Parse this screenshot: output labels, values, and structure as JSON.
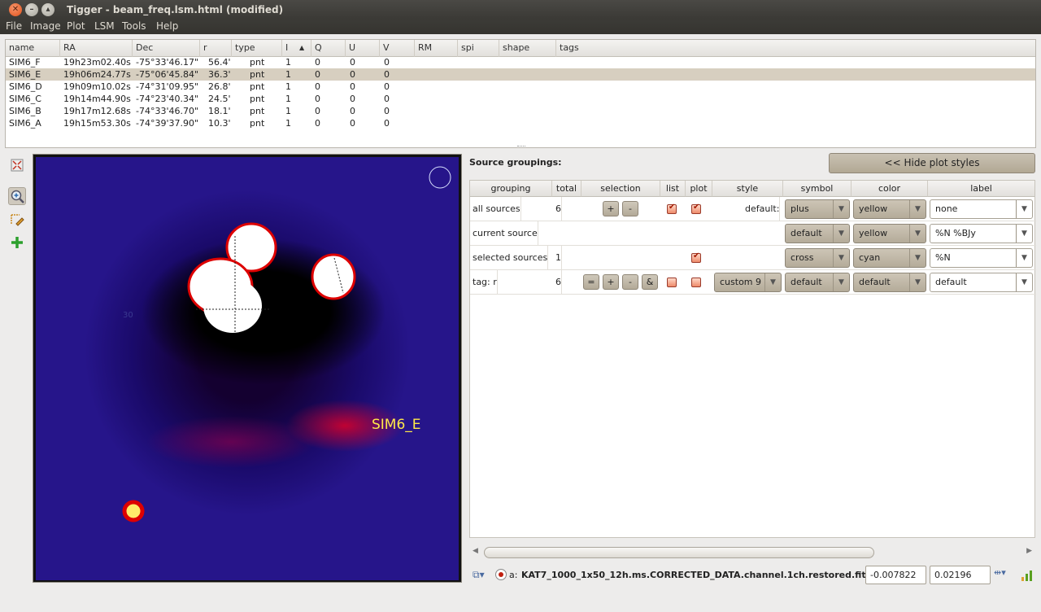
{
  "window": {
    "title": "Tigger - beam_freq.lsm.html (modified)"
  },
  "menu": [
    "File",
    "Image",
    "Plot",
    "LSM",
    "Tools",
    "Help"
  ],
  "source_table": {
    "columns": [
      "name",
      "RA",
      "Dec",
      "r",
      "type",
      "I",
      "Q",
      "U",
      "V",
      "RM",
      "spi",
      "shape",
      "tags"
    ],
    "sort_indicator": "▲",
    "rows": [
      {
        "name": "SIM6_F",
        "ra": "19h23m02.40s",
        "dec": "-75°33'46.17\"",
        "r": "56.4'",
        "type": "pnt",
        "i": "1",
        "q": "0",
        "u": "0",
        "v": "0"
      },
      {
        "name": "SIM6_E",
        "ra": "19h06m24.77s",
        "dec": "-75°06'45.84\"",
        "r": "36.3'",
        "type": "pnt",
        "i": "1",
        "q": "0",
        "u": "0",
        "v": "0",
        "selected": true
      },
      {
        "name": "SIM6_D",
        "ra": "19h09m10.02s",
        "dec": "-74°31'09.95\"",
        "r": "26.8'",
        "type": "pnt",
        "i": "1",
        "q": "0",
        "u": "0",
        "v": "0"
      },
      {
        "name": "SIM6_C",
        "ra": "19h14m44.90s",
        "dec": "-74°23'40.34\"",
        "r": "24.5'",
        "type": "pnt",
        "i": "1",
        "q": "0",
        "u": "0",
        "v": "0"
      },
      {
        "name": "SIM6_B",
        "ra": "19h17m12.68s",
        "dec": "-74°33'46.70\"",
        "r": "18.1'",
        "type": "pnt",
        "i": "1",
        "q": "0",
        "u": "0",
        "v": "0"
      },
      {
        "name": "SIM6_A",
        "ra": "19h15m53.30s",
        "dec": "-74°39'37.90\"",
        "r": "10.3'",
        "type": "pnt",
        "i": "1",
        "q": "0",
        "u": "0",
        "v": "0"
      }
    ]
  },
  "image": {
    "source_label": "SIM6_E",
    "grid_label": "30"
  },
  "groupings": {
    "title": "Source groupings:",
    "hide_button": "<< Hide plot styles",
    "columns": [
      "grouping",
      "total",
      "selection",
      "list",
      "plot",
      "style",
      "symbol",
      "color",
      "label"
    ],
    "rows": [
      {
        "grouping": "all sources",
        "total": "6",
        "style": "default:",
        "symbol": "plus",
        "color": "yellow",
        "label": "none",
        "list": true,
        "plot": true
      },
      {
        "grouping": "current source",
        "total": "",
        "style": "",
        "symbol": "default",
        "color": "yellow",
        "label": "%N %BJy"
      },
      {
        "grouping": "selected sources",
        "total": "1",
        "style": "",
        "symbol": "cross",
        "color": "cyan",
        "label": "%N",
        "plot": true
      },
      {
        "grouping": "tag: r",
        "total": "6",
        "style": "custom 9",
        "symbol": "default",
        "color": "default",
        "label": "default",
        "list": false,
        "plot": false
      }
    ],
    "selection_buttons": [
      "=",
      "+",
      "-",
      "&"
    ],
    "sel_plus": "+",
    "sel_minus": "-"
  },
  "status": {
    "layer_prefix": "a:",
    "filename": "KAT7_1000_1x50_12h.ms.CORRECTED_DATA.channel.1ch.restored.fits",
    "min_value": "-0.007822",
    "max_value": "0.02196"
  },
  "colors": {
    "accent": "#e0521b",
    "selection": "#d7cfc0",
    "label_yellow": "#ffe94a"
  }
}
